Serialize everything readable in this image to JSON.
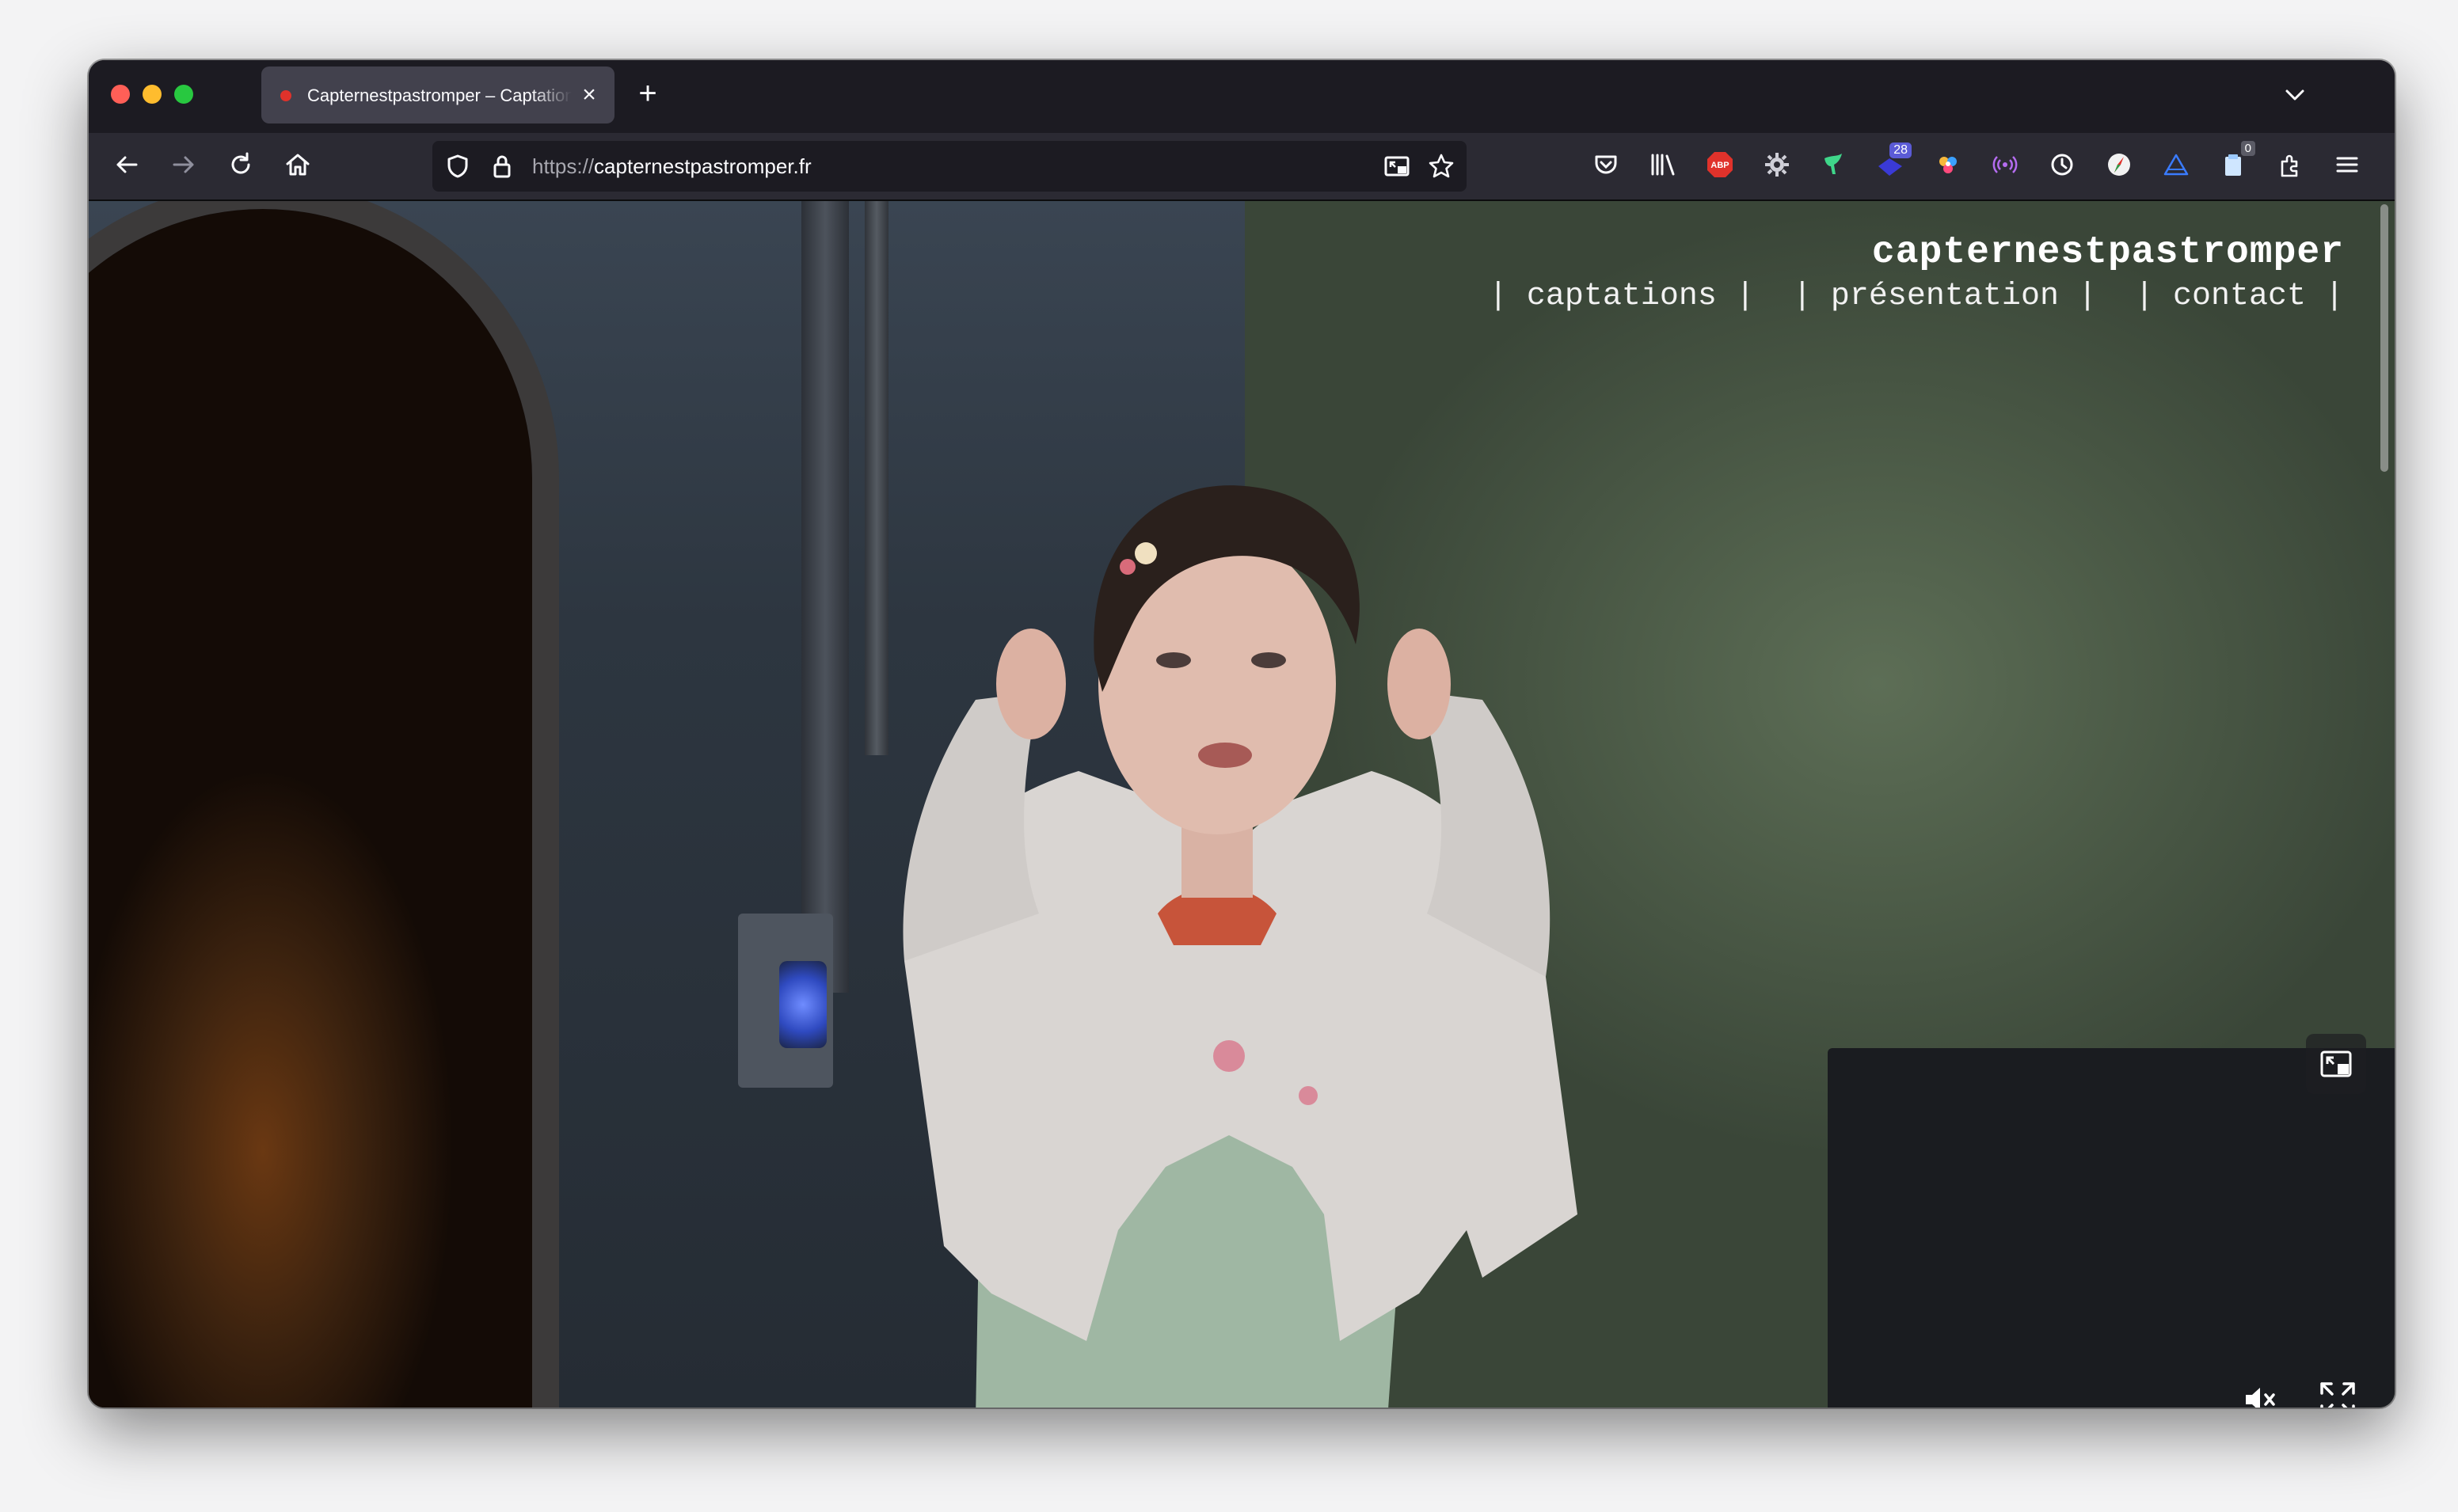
{
  "browser": {
    "tab": {
      "title": "Capternestpastromper – Captations",
      "close_icon": "close-icon"
    },
    "new_tab_label": "+",
    "url": {
      "scheme": "https://",
      "host": "capternestpastromper.fr"
    },
    "extensions": [
      {
        "name": "pocket-icon"
      },
      {
        "name": "library-icon"
      },
      {
        "name": "adblock-plus-icon",
        "text": "ABP"
      },
      {
        "name": "gear-extension-icon"
      },
      {
        "name": "bird-extension-icon"
      },
      {
        "name": "badge-extension-icon",
        "badge": "28"
      },
      {
        "name": "colors-extension-icon"
      },
      {
        "name": "signal-extension-icon"
      },
      {
        "name": "clock-extension-icon"
      },
      {
        "name": "compass-extension-icon"
      },
      {
        "name": "triangle-extension-icon"
      },
      {
        "name": "clipboard-extension-icon",
        "badge": "0"
      },
      {
        "name": "puzzle-icon"
      },
      {
        "name": "menu-icon"
      }
    ]
  },
  "site": {
    "title": "capternestpastromper",
    "nav": [
      {
        "label": "| captations |"
      },
      {
        "label": "| présentation |"
      },
      {
        "label": "| contact |"
      }
    ]
  },
  "colors": {
    "toolbar": "#2b2a33",
    "tabstrip": "#1c1b22",
    "urlbar": "#1c1b22",
    "text": "#fbfbfe"
  }
}
